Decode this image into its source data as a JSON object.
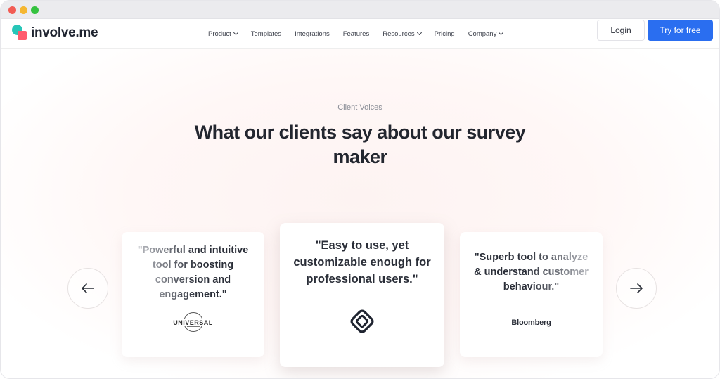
{
  "nav": {
    "logo_text": "involve.me",
    "links": [
      {
        "label": "Product",
        "has_dropdown": true
      },
      {
        "label": "Templates",
        "has_dropdown": false
      },
      {
        "label": "Integrations",
        "has_dropdown": false
      },
      {
        "label": "Features",
        "has_dropdown": false
      },
      {
        "label": "Resources",
        "has_dropdown": true
      },
      {
        "label": "Pricing",
        "has_dropdown": false
      },
      {
        "label": "Company",
        "has_dropdown": true
      }
    ],
    "login_label": "Login",
    "cta_label": "Try for free"
  },
  "hero": {
    "eyebrow": "Client Voices",
    "headline": "What our clients say about our survey maker"
  },
  "testimonials": [
    {
      "quote": "\"Powerful and intuitive tool for boosting conversion and engagement.\"",
      "brand": "UNIVERSAL",
      "icon": "universal-logo"
    },
    {
      "quote": "\"Easy to use, yet customizable enough for professional users.\"",
      "brand": "",
      "icon": "capterra-diamond-logo"
    },
    {
      "quote": "\"Superb tool to analyze & understand customer behaviour.\"",
      "brand": "Bloomberg",
      "icon": "bloomberg-logo"
    }
  ],
  "colors": {
    "accent": "#2a6ef0",
    "logo_teal": "#27c6b8",
    "logo_coral": "#ff5c6e",
    "text_dark": "#23262f"
  },
  "icons": {
    "prev": "arrow-left-icon",
    "next": "arrow-right-icon"
  }
}
